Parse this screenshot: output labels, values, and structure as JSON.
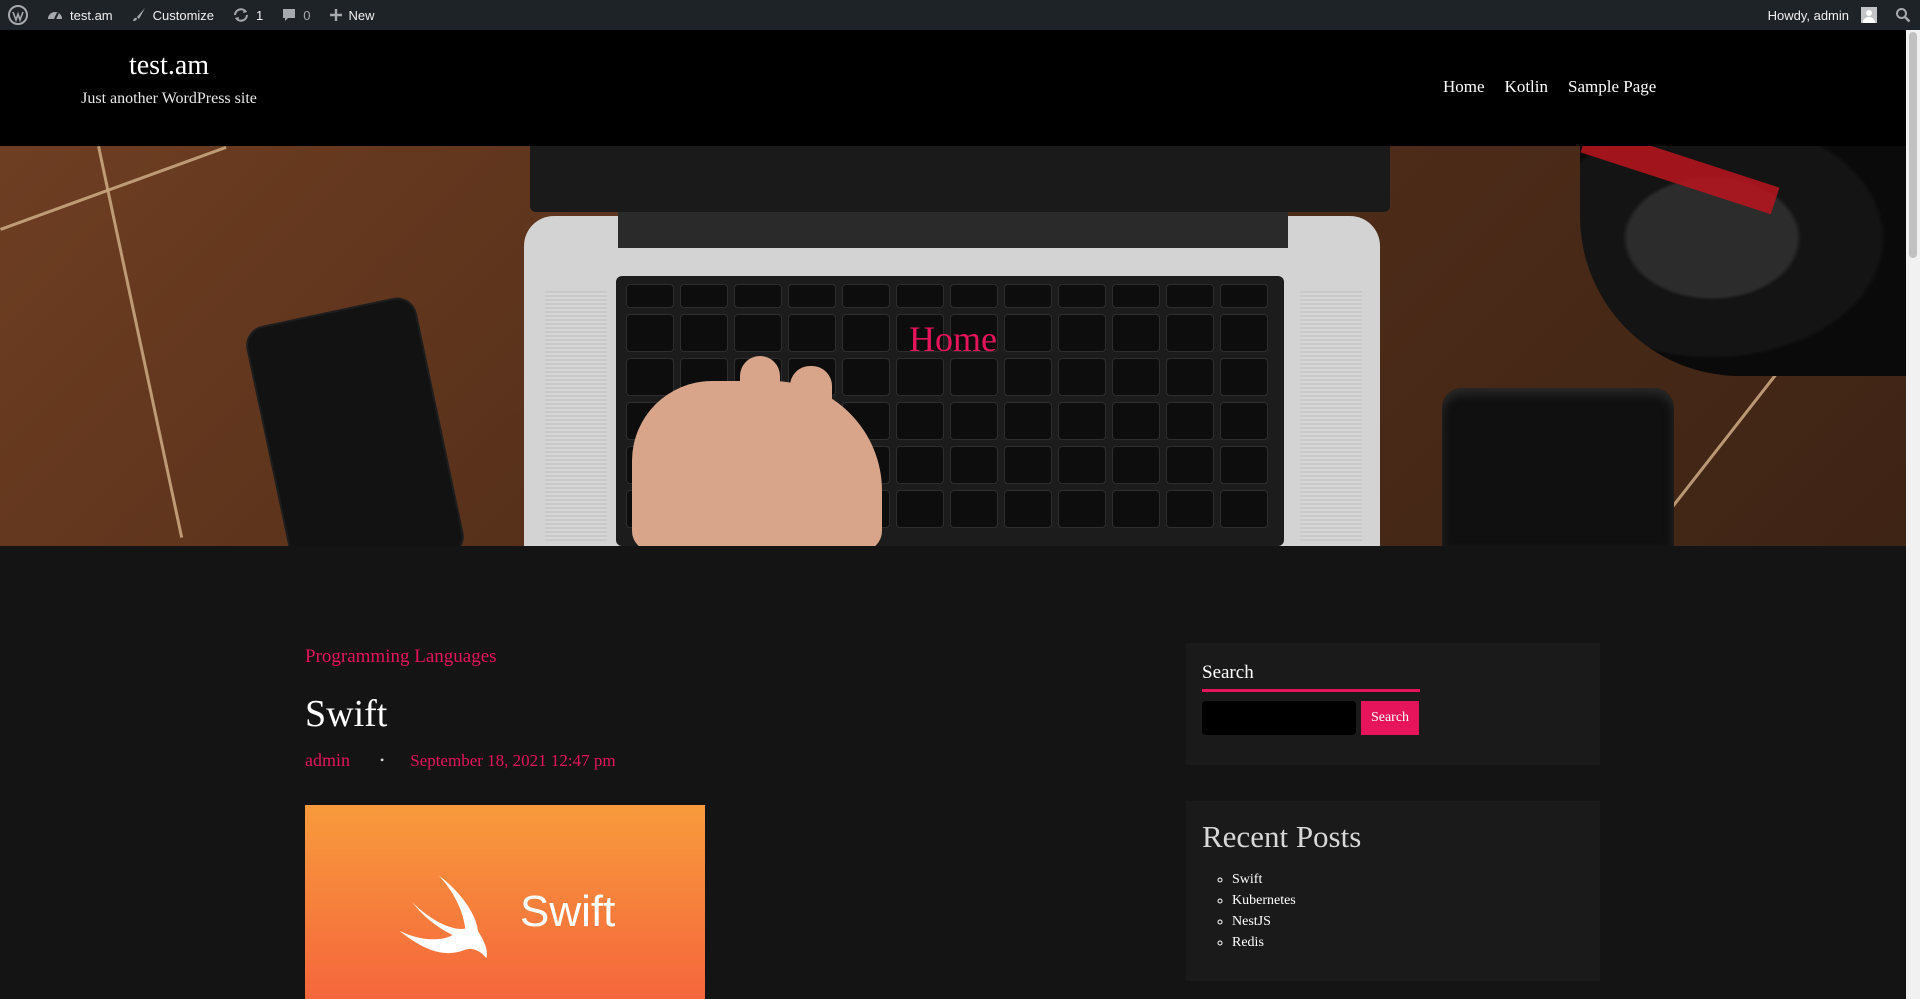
{
  "admin_bar": {
    "site": "test.am",
    "customize": "Customize",
    "updates": "1",
    "comments": "0",
    "new": "New",
    "greeting": "Howdy, admin"
  },
  "header": {
    "site_title": "test.am",
    "tagline": "Just another WordPress site",
    "nav": [
      "Home",
      "Kotlin",
      "Sample Page"
    ]
  },
  "hero": {
    "title": "Home"
  },
  "post": {
    "category": "Programming Languages",
    "title": "Swift",
    "author": "admin",
    "date": "September 18, 2021 12:47 pm",
    "thumbnail_text": "Swift"
  },
  "sidebar": {
    "search": {
      "title": "Search",
      "button": "Search",
      "value": ""
    },
    "recent": {
      "title": "Recent Posts",
      "items": [
        "Swift",
        "Kubernetes",
        "NestJS",
        "Redis"
      ]
    }
  },
  "colors": {
    "accent": "#e6145a",
    "admin_bar": "#1d2327",
    "header": "#000000",
    "content_bg": "#141414",
    "widget_bg": "#1a1a1a"
  },
  "icons": [
    "wordpress-icon",
    "dashboard-icon",
    "brush-icon",
    "updates-icon",
    "comment-icon",
    "plus-icon",
    "avatar-icon",
    "search-icon"
  ]
}
